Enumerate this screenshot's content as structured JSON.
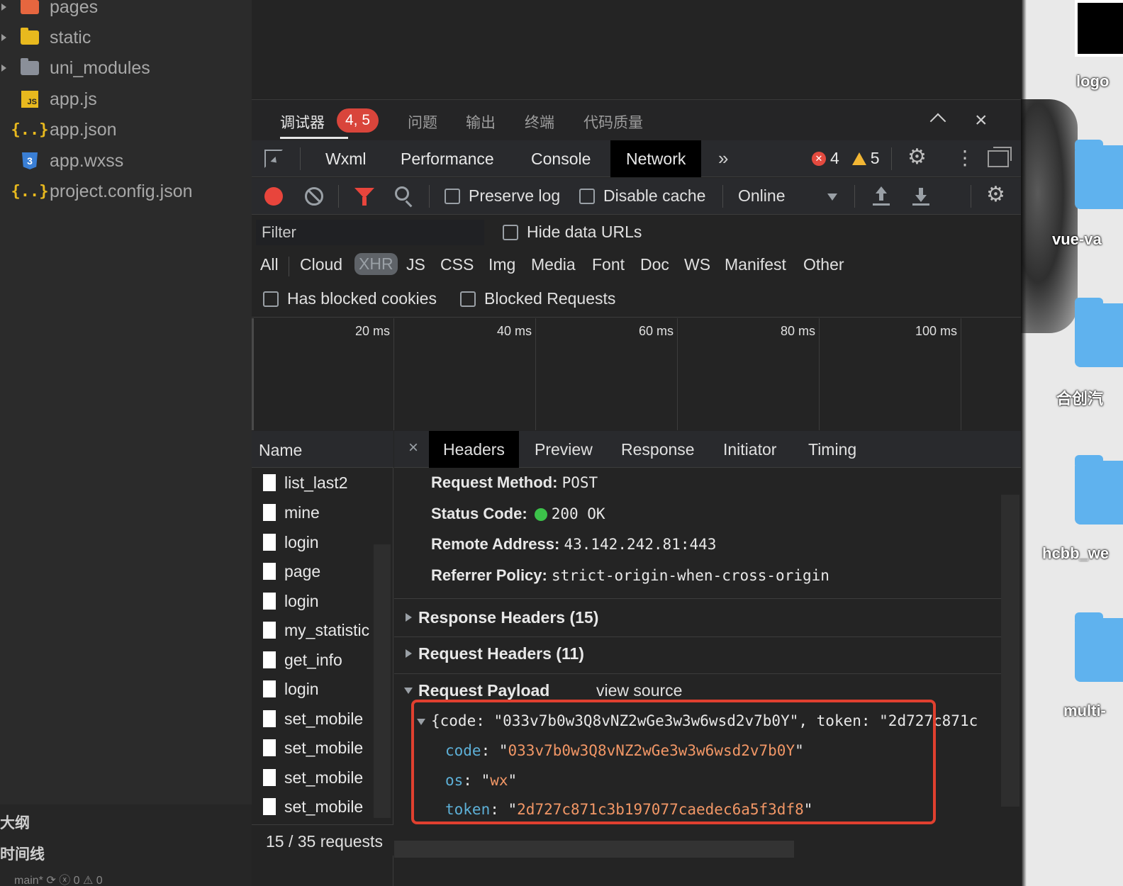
{
  "explorer": {
    "items": [
      {
        "name": "pages",
        "type": "folder-special",
        "expandable": true
      },
      {
        "name": "static",
        "type": "folder-static",
        "expandable": true
      },
      {
        "name": "uni_modules",
        "type": "folder",
        "expandable": true
      },
      {
        "name": "app.js",
        "type": "js-file",
        "expandable": false
      },
      {
        "name": "app.json",
        "type": "json-file",
        "expandable": false
      },
      {
        "name": "app.wxss",
        "type": "css-file",
        "expandable": false
      },
      {
        "name": "project.config.json",
        "type": "json-file",
        "expandable": false
      }
    ],
    "icons": {
      "js": "JS",
      "json": "{..}",
      "css": "3"
    },
    "outline_label": "大纲",
    "timeline_label": "时间线",
    "status_text": "main*   ⟳   ⓧ 0 ⚠ 0"
  },
  "panel_tabs": {
    "debugger": "调试器",
    "error_badge": "4, 5",
    "issues": "问题",
    "output": "输出",
    "terminal": "终端",
    "code_quality": "代码质量"
  },
  "devtools": {
    "tabs": [
      "Wxml",
      "Performance",
      "Console",
      "Network"
    ],
    "active_tab": "Network",
    "more_tabs_icon": "»",
    "error_count": "4",
    "warning_count": "5",
    "error_icon_glyph": "✕",
    "kebab_glyph": "⋮",
    "gear_glyph": "⚙"
  },
  "network_toolbar": {
    "preserve_log": "Preserve log",
    "disable_cache": "Disable cache",
    "throttling": "Online"
  },
  "filter": {
    "placeholder": "Filter",
    "hide_data_urls": "Hide data URLs",
    "types": [
      "All",
      "Cloud",
      "XHR",
      "JS",
      "CSS",
      "Img",
      "Media",
      "Font",
      "Doc",
      "WS",
      "Manifest",
      "Other"
    ],
    "selected_type": "XHR",
    "has_blocked_cookies": "Has blocked cookies",
    "blocked_requests": "Blocked Requests"
  },
  "timeline": {
    "ticks": [
      "20 ms",
      "40 ms",
      "60 ms",
      "80 ms",
      "100 ms"
    ]
  },
  "requests": {
    "header": "Name",
    "items": [
      "list_last2",
      "mine",
      "login",
      "page",
      "login",
      "my_statistic",
      "get_info",
      "login",
      "set_mobile",
      "set_mobile",
      "set_mobile",
      "set_mobile"
    ],
    "summary": "15 / 35 requests"
  },
  "details": {
    "close_glyph": "×",
    "tabs": [
      "Headers",
      "Preview",
      "Response",
      "Initiator",
      "Timing"
    ],
    "active_tab": "Headers",
    "general": {
      "method_label": "Request Method:",
      "method": "POST",
      "status_label": "Status Code:",
      "status": "200 OK",
      "status_color": "#3cc24a",
      "remote_label": "Remote Address:",
      "remote": "43.142.242.81:443",
      "referrer_label": "Referrer Policy:",
      "referrer": "strict-origin-when-cross-origin"
    },
    "response_headers": "Response Headers (15)",
    "request_headers": "Request Headers (11)",
    "payload_title": "Request Payload",
    "view_source": "view source",
    "payload_summary": "{code: \"033v7b0w3Q8vNZ2wGe3w3w6wsd2v7b0Y\", token: \"2d727c871c",
    "payload": {
      "code_key": "code",
      "code_val": "033v7b0w3Q8vNZ2wGe3w3w6wsd2v7b0Y",
      "os_key": "os",
      "os_val": "wx",
      "token_key": "token",
      "token_val": "2d727c871c3b197077caedec6a5f3df8"
    },
    "highlight_color": "#e0402f"
  },
  "desktop": {
    "labels": [
      "logo",
      "vue-va",
      "合创汽",
      "hcbb_we",
      "multi-"
    ]
  }
}
